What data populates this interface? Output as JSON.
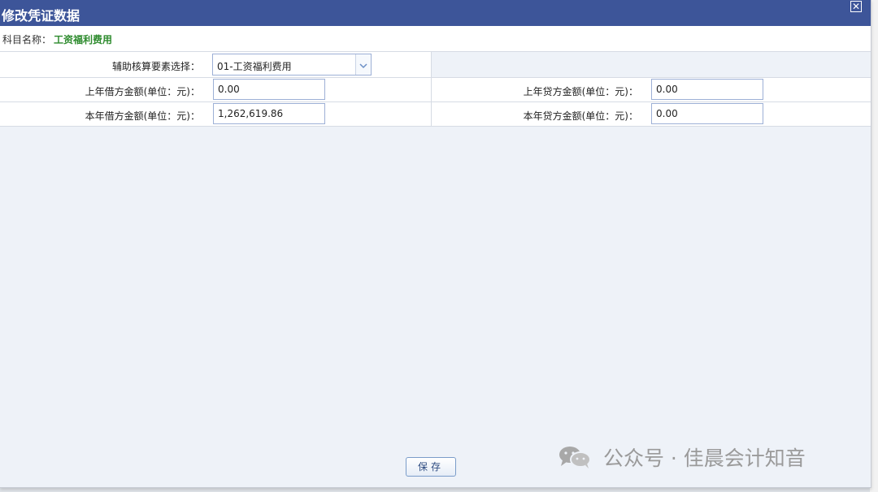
{
  "dialog": {
    "title": "修改凭证数据",
    "close_symbol": "✕"
  },
  "subject": {
    "label": "科目名称：",
    "value": "工资福利费用"
  },
  "form": {
    "aux_label": "辅助核算要素选择：",
    "aux_value": "01-工资福利费用",
    "prev_debit_label": "上年借方金额(单位：元)：",
    "prev_debit_value": "0.00",
    "prev_credit_label": "上年贷方金额(单位：元)：",
    "prev_credit_value": "0.00",
    "curr_debit_label": "本年借方金额(单位：元)：",
    "curr_debit_value": "1,262,619.86",
    "curr_credit_label": "本年贷方金额(单位：元)：",
    "curr_credit_value": "0.00"
  },
  "actions": {
    "save_label": "保存"
  },
  "watermark": {
    "text": "公众号 · 佳晨会计知音",
    "icon": "wechat-icon"
  },
  "colors": {
    "titlebar": "#3d5599",
    "subject_value": "#2e8b2e",
    "input_border": "#9db0d6"
  }
}
